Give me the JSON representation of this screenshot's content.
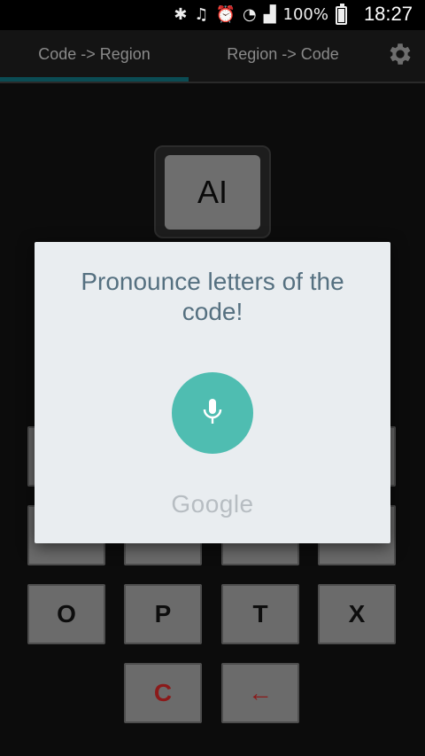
{
  "status_bar": {
    "icons": [
      "bluetooth-icon",
      "mute-icon",
      "alarm-icon",
      "wifi-icon",
      "signal-icon"
    ],
    "battery": "100%",
    "time": "18:27"
  },
  "tabs": [
    {
      "label": "Code -> Region",
      "active": true
    },
    {
      "label": "Region -> Code",
      "active": false
    }
  ],
  "settings_icon": "gear-icon",
  "display": {
    "value": "AI"
  },
  "keypad": {
    "row3": [
      "O",
      "P",
      "T",
      "X"
    ],
    "row4": [
      "C",
      "←"
    ]
  },
  "dialog": {
    "title": "Pronounce letters of the code!",
    "mic_icon": "microphone-icon",
    "brand": "Google"
  },
  "colors": {
    "accent": "#0b4c54",
    "mic": "#4fbdb1",
    "dialog_bg": "#e9edf0",
    "clear_key_text": "#8b1a1a"
  }
}
